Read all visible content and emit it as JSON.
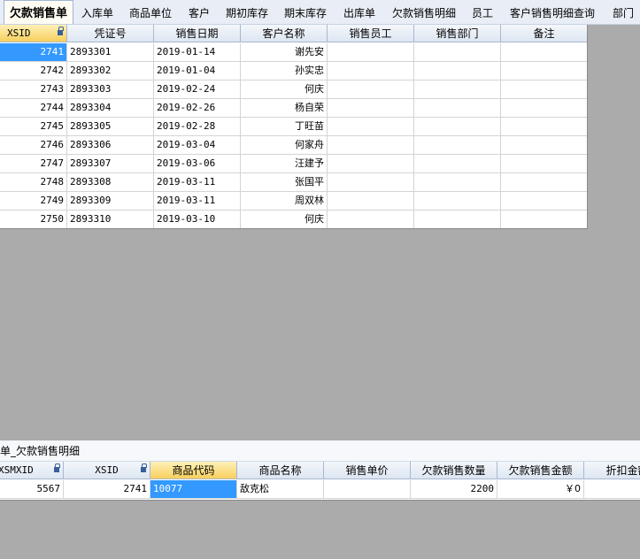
{
  "tabs": [
    {
      "label": "欠款销售单",
      "active": true
    },
    {
      "label": "入库单"
    },
    {
      "label": "商品单位"
    },
    {
      "label": "客户"
    },
    {
      "label": "期初库存"
    },
    {
      "label": "期末库存"
    },
    {
      "label": "出库单"
    },
    {
      "label": "欠款销售明细"
    },
    {
      "label": "员工"
    },
    {
      "label": "客户销售明细查询"
    },
    {
      "label": "部门"
    }
  ],
  "main_grid": {
    "columns": [
      "XSID",
      "凭证号",
      "销售日期",
      "客户名称",
      "销售员工",
      "销售部门",
      "备注"
    ],
    "rows": [
      [
        "2741",
        "2893301",
        "2019-01-14",
        "谢先安",
        "",
        "",
        ""
      ],
      [
        "2742",
        "2893302",
        "2019-01-04",
        "孙实忠",
        "",
        "",
        ""
      ],
      [
        "2743",
        "2893303",
        "2019-02-24",
        "何庆",
        "",
        "",
        ""
      ],
      [
        "2744",
        "2893304",
        "2019-02-26",
        "杨自荣",
        "",
        "",
        ""
      ],
      [
        "2745",
        "2893305",
        "2019-02-28",
        "丁旺苗",
        "",
        "",
        ""
      ],
      [
        "2746",
        "2893306",
        "2019-03-04",
        "何家舟",
        "",
        "",
        ""
      ],
      [
        "2747",
        "2893307",
        "2019-03-06",
        "汪建予",
        "",
        "",
        ""
      ],
      [
        "2748",
        "2893308",
        "2019-03-11",
        "张国平",
        "",
        "",
        ""
      ],
      [
        "2749",
        "2893309",
        "2019-03-11",
        "周双林",
        "",
        "",
        ""
      ],
      [
        "2750",
        "2893310",
        "2019-03-10",
        "何庆",
        "",
        "",
        ""
      ]
    ]
  },
  "detail_panel": {
    "caption": "单_欠款销售明细",
    "columns": [
      "XSMXID",
      "XSID",
      "商品代码",
      "商品名称",
      "销售单价",
      "欠款销售数量",
      "欠款销售金额",
      "折扣金额"
    ],
    "rows": [
      [
        "5567",
        "2741",
        "10077",
        "敌克松",
        "",
        "2200",
        "￥0",
        ""
      ]
    ]
  },
  "colors": {
    "background": "#ababab",
    "selection": "#3399ff",
    "active_header": "#f7cf5d"
  }
}
